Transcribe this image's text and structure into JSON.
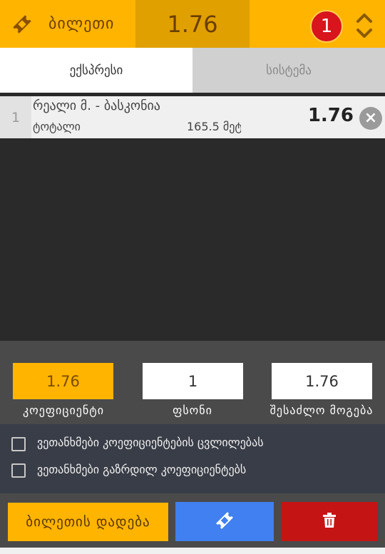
{
  "header": {
    "title": "ბილეთი",
    "odds": "1.76",
    "count": "1",
    "icons": {
      "ticket": "ticket-icon",
      "toggle": "expand-collapse-icon"
    }
  },
  "tabs": [
    {
      "label": "ექსპრესი",
      "active": true
    },
    {
      "label": "სისტემა",
      "active": false
    }
  ],
  "bets": [
    {
      "number": "1",
      "event": "რეალი მ. - ბასკონია",
      "market": "ტოტალი",
      "line": "165.5 მეტ",
      "odds": "1.76"
    }
  ],
  "summary": {
    "odds": {
      "value": "1.76",
      "label": "კოეფიციენტი"
    },
    "stake": {
      "value": "1",
      "label": "ფსონი"
    },
    "potential_win": {
      "value": "1.76",
      "label": "შესაძლო მოგება"
    }
  },
  "options": [
    {
      "label": "ვეთანხმები კოეფიციენტების ცვლილებას",
      "checked": false
    },
    {
      "label": "ვეთანხმები გაზრდილ კოეფიციენტებს",
      "checked": false
    }
  ],
  "actions": {
    "place_label": "ბილეთის დადება",
    "save_icon": "ticket-icon",
    "delete_icon": "trash-icon"
  },
  "colors": {
    "accent": "#ffb400",
    "save": "#4080f0",
    "delete": "#c41414",
    "badge": "#d8141c"
  }
}
